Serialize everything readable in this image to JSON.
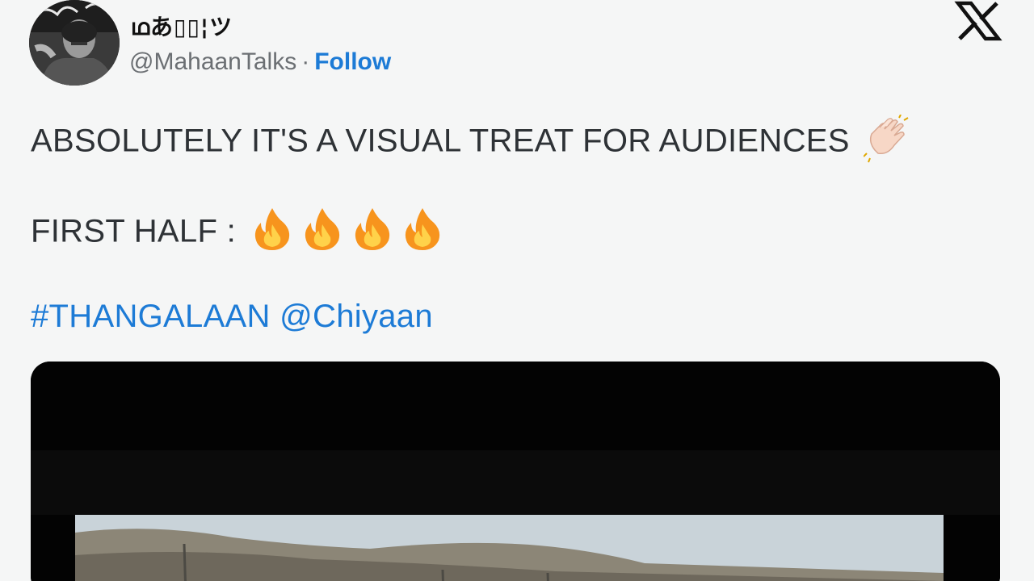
{
  "author": {
    "display_name": "ഥあ▯▯¦ツ",
    "handle": "@MahaanTalks",
    "separator": "·",
    "follow_label": "Follow"
  },
  "tweet": {
    "line1": "ABSOLUTELY IT'S A VISUAL TREAT FOR AUDIENCES",
    "line2": "FIRST HALF :",
    "hashtag": "#THANGALAAN",
    "mention": "@Chiyaan"
  },
  "icons": {
    "brand": "x-logo-icon",
    "clap": "clapping-hands-icon",
    "fire": "fire-icon"
  },
  "colors": {
    "link": "#1d7bd6",
    "text": "#2e3236",
    "muted": "#6b6f73",
    "background": "#f5f6f6"
  }
}
